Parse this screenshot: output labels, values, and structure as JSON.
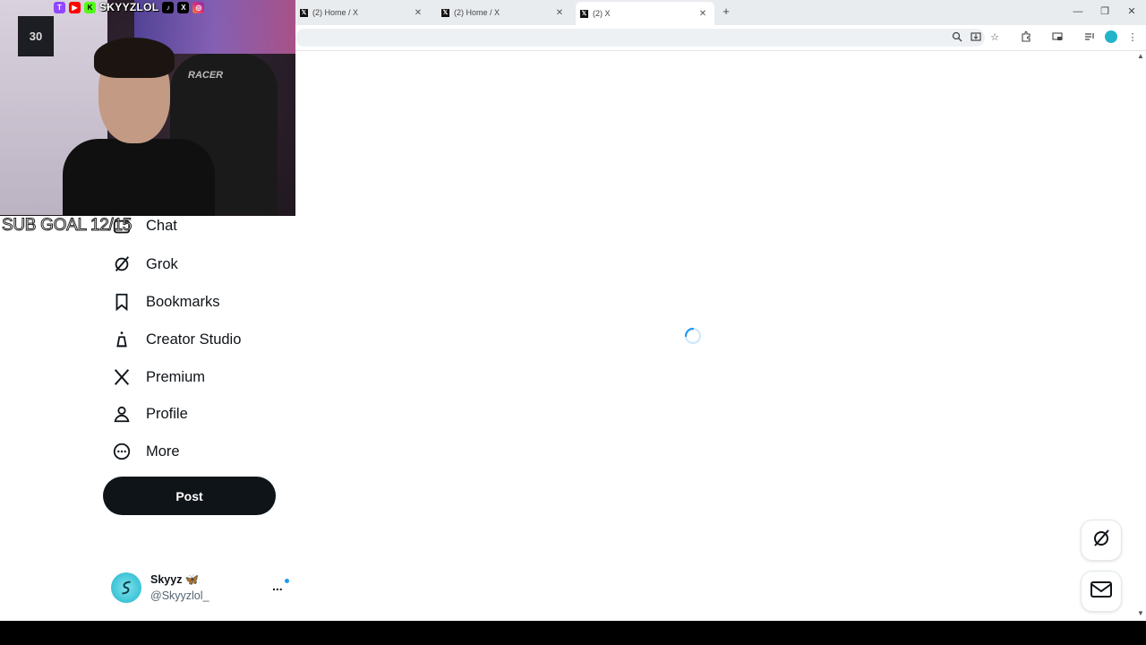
{
  "browser": {
    "tabs": [
      {
        "title": "(2) Home / X",
        "favicon": "x-logo-icon",
        "active": false
      },
      {
        "title": "(2) Home / X",
        "favicon": "x-logo-icon",
        "active": false
      },
      {
        "title": "(2) X",
        "favicon": "x-logo-icon",
        "active": true
      }
    ],
    "new_tab": "+",
    "toolbar_icons": [
      "zoom-icon",
      "install-app-icon",
      "bookmark-star-icon",
      "extensions-icon",
      "cast-icon",
      "media-controls-icon",
      "profile-icon",
      "menu-dots-icon"
    ]
  },
  "overlay": {
    "handle": "SKYYZLOL",
    "social_icons": [
      "twitch-icon",
      "youtube-icon",
      "kick-icon",
      "tiktok-icon",
      "x-icon",
      "instagram-icon"
    ],
    "jersey_number": "30",
    "chair_text": "RACER",
    "sub_goal": "SUB GOAL 12/15"
  },
  "sidebar": {
    "chat_label": "Chat",
    "items": [
      {
        "label": "Grok",
        "icon": "grok-icon"
      },
      {
        "label": "Bookmarks",
        "icon": "bookmark-icon"
      },
      {
        "label": "Creator Studio",
        "icon": "creator-studio-icon"
      },
      {
        "label": "Premium",
        "icon": "x-logo-icon"
      },
      {
        "label": "Profile",
        "icon": "profile-icon"
      },
      {
        "label": "More",
        "icon": "more-circle-icon"
      }
    ],
    "post_label": "Post"
  },
  "account": {
    "name": "Skyyz 🦋",
    "handle": "@Skyyzlol_",
    "more": "..."
  },
  "main": {
    "state": "loading"
  },
  "floating": {
    "grok": "grok-icon",
    "messages": "mail-icon"
  }
}
